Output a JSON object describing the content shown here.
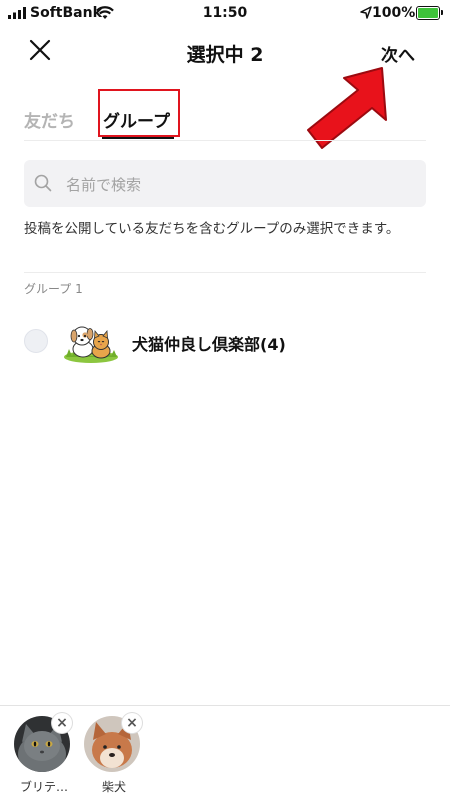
{
  "status_bar": {
    "carrier": "SoftBank",
    "time": "11:50",
    "battery": "100%"
  },
  "header": {
    "title": "選択中 2",
    "next_label": "次へ",
    "close_icon": "close-icon"
  },
  "tabs": [
    {
      "label": "友だち",
      "active": false
    },
    {
      "label": "グループ",
      "active": true
    }
  ],
  "search": {
    "placeholder": "名前で検索",
    "icon": "search-icon"
  },
  "description": "投稿を公開している友だちを含むグループのみ選択できます。",
  "section": {
    "label": "グループ 1"
  },
  "groups": [
    {
      "name": "犬猫仲良し倶楽部(4)",
      "selected": false
    }
  ],
  "selected_items": [
    {
      "label": "ブリテ…",
      "remove": "×"
    },
    {
      "label": "柴犬",
      "remove": "×"
    }
  ],
  "colors": {
    "highlight_box": "#e0141e",
    "arrow": "#e8121b",
    "battery": "#3ec23a",
    "search_bg": "#f2f2f4"
  }
}
